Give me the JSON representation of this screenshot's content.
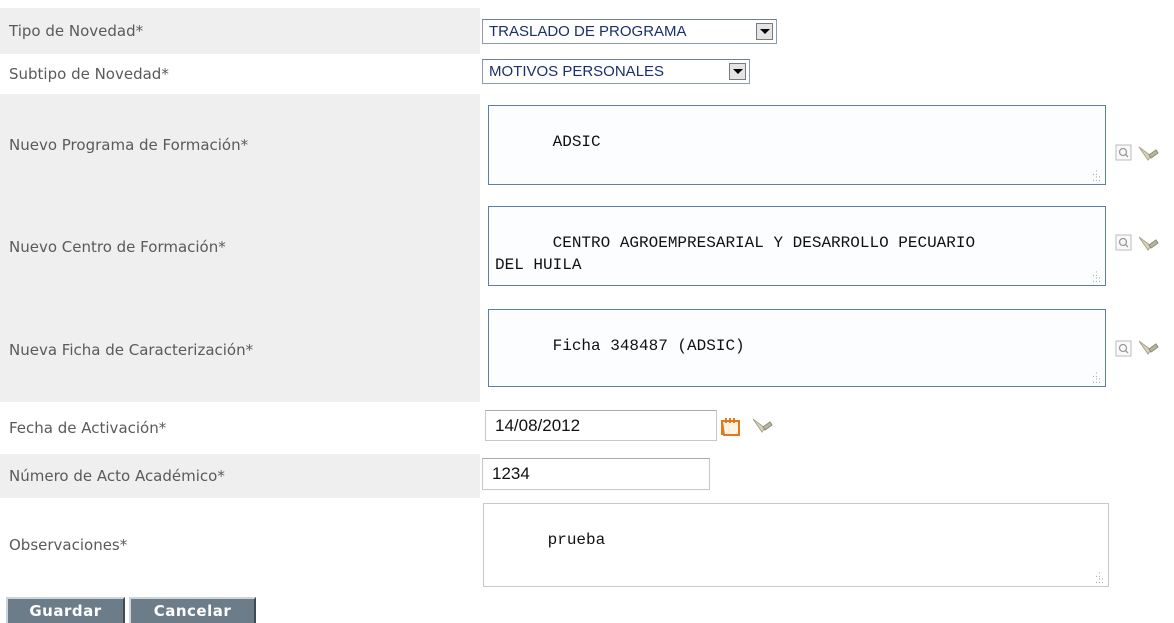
{
  "form": {
    "tipo_novedad": {
      "label": "Tipo de Novedad*",
      "value": "TRASLADO DE PROGRAMA"
    },
    "subtipo_novedad": {
      "label": "Subtipo de Novedad*",
      "value": "MOTIVOS PERSONALES"
    },
    "nuevo_programa": {
      "label": "Nuevo Programa de Formación*",
      "value": "ADSIC"
    },
    "nuevo_centro": {
      "label": "Nuevo Centro de Formación*",
      "value": "CENTRO AGROEMPRESARIAL Y DESARROLLO PECUARIO\nDEL HUILA"
    },
    "nueva_ficha": {
      "label": "Nueva Ficha de Caracterización*",
      "value": "Ficha 348487 (ADSIC)"
    },
    "fecha_activacion": {
      "label": "Fecha de Activación*",
      "value": "14/08/2012"
    },
    "numero_acto": {
      "label": "Número de Acto Académico*",
      "value": "1234"
    },
    "observaciones": {
      "label": "Observaciones*",
      "value": "prueba"
    }
  },
  "buttons": {
    "save": "Guardar",
    "cancel": "Cancelar"
  },
  "icons": {
    "search": "search-icon",
    "clear": "pencil-eraser-icon",
    "calendar": "calendar-icon"
  },
  "colors": {
    "row_grey": "#efefef",
    "label_text": "#5a5a5a",
    "select_text": "#1a2f6b",
    "textarea_border": "#5c7fa6",
    "button_bg": "#6c7c88",
    "calendar_icon": "#e07a1f"
  }
}
